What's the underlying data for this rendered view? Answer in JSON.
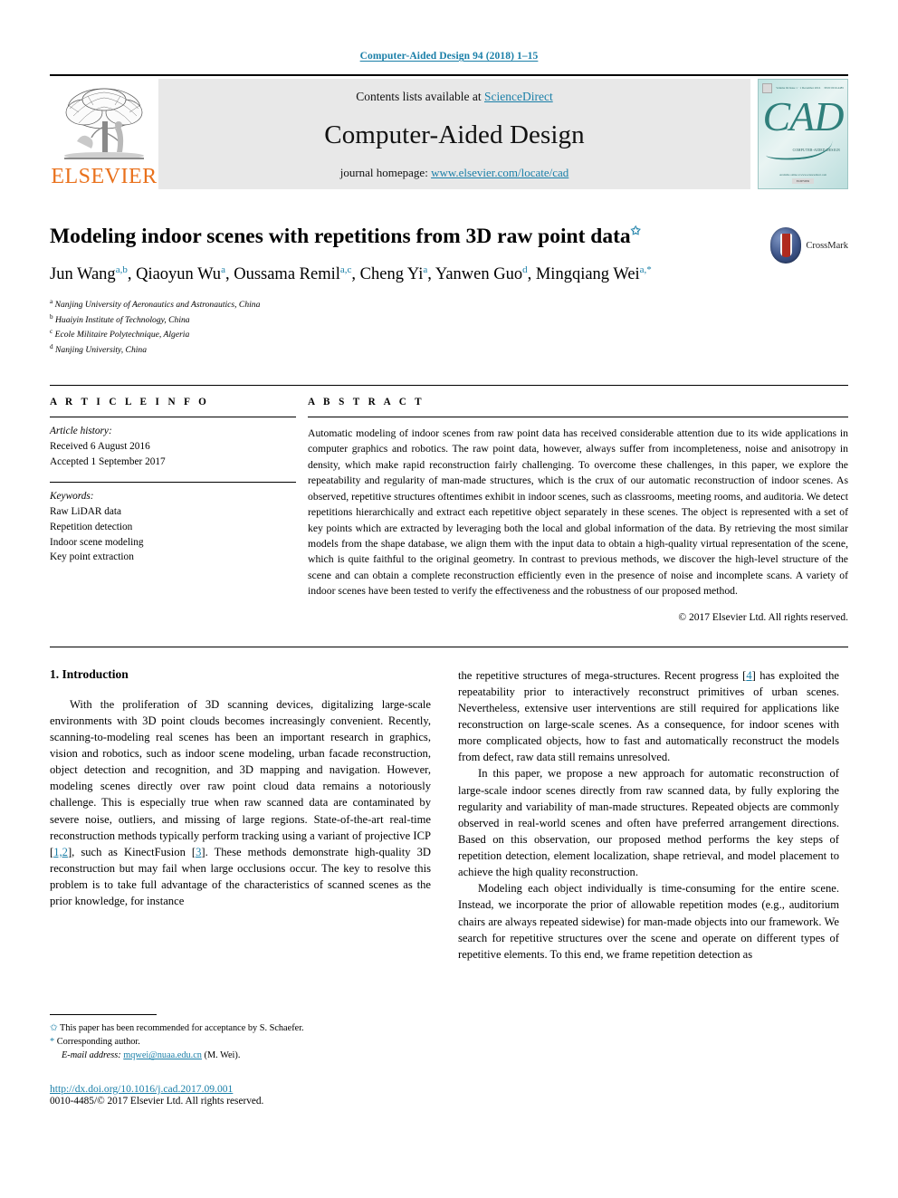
{
  "running_head": "Computer-Aided Design 94 (2018) 1–15",
  "banner": {
    "publisher": "ELSEVIER",
    "contents_prefix": "Contents lists available at ",
    "contents_link": "ScienceDirect",
    "journal_name": "Computer-Aided Design",
    "homepage_prefix": "journal homepage: ",
    "homepage_link": "www.elsevier.com/locate/cad",
    "cover": {
      "letters": "CAD",
      "subtitle": "COMPUTER-AIDED DESIGN",
      "top_left": "Volume 94 Issue 1 · 1 December 2016",
      "top_right": "ISSN 0010-4485",
      "bottom": "Available online at www.sciencedirect.com",
      "bottom_box": "ELSEVIER"
    }
  },
  "article": {
    "title": "Modeling indoor scenes with repetitions from 3D raw point data",
    "title_star": "✩",
    "authors": [
      {
        "name": "Jun Wang",
        "sup": "a,b",
        "sep": ", "
      },
      {
        "name": "Qiaoyun Wu",
        "sup": "a",
        "sep": ", "
      },
      {
        "name": "Oussama Remil",
        "sup": "a,c",
        "sep": ", "
      },
      {
        "name": "Cheng Yi",
        "sup": "a",
        "sep": ", "
      },
      {
        "name": "Yanwen Guo",
        "sup": "d",
        "sep": ", "
      },
      {
        "name": "Mingqiang Wei",
        "sup": "a,*",
        "sep": ""
      }
    ],
    "affiliations": [
      {
        "mark": "a",
        "text": "Nanjing University of Aeronautics and Astronautics, China"
      },
      {
        "mark": "b",
        "text": "Huaiyin Institute of Technology, China"
      },
      {
        "mark": "c",
        "text": "Ecole Militaire Polytechnique, Algeria"
      },
      {
        "mark": "d",
        "text": "Nanjing University, China"
      }
    ],
    "crossmark_label": "CrossMark"
  },
  "article_info": {
    "heading": "A R T I C L E   I N F O",
    "history_label": "Article history:",
    "history": [
      "Received 6 August 2016",
      "Accepted 1 September 2017"
    ],
    "keywords_label": "Keywords:",
    "keywords": [
      "Raw LiDAR data",
      "Repetition detection",
      "Indoor scene modeling",
      "Key point extraction"
    ]
  },
  "abstract": {
    "heading": "A B S T R A C T",
    "text": "Automatic modeling of indoor scenes from raw point data has received considerable attention due to its wide applications in computer graphics and robotics. The raw point data, however, always suffer from incompleteness, noise and anisotropy in density, which make rapid reconstruction fairly challenging. To overcome these challenges, in this paper, we explore the repeatability and regularity of man-made structures, which is the crux of our automatic reconstruction of indoor scenes. As observed, repetitive structures oftentimes exhibit in indoor scenes, such as classrooms, meeting rooms, and auditoria. We detect repetitions hierarchically and extract each repetitive object separately in these scenes. The object is represented with a set of key points which are extracted by leveraging both the local and global information of the data. By retrieving the most similar models from the shape database, we align them with the input data to obtain a high-quality virtual representation of the scene, which is quite faithful to the original geometry. In contrast to previous methods, we discover the high-level structure of the scene and can obtain a complete reconstruction efficiently even in the presence of noise and incomplete scans. A variety of indoor scenes have been tested to verify the effectiveness and the robustness of our proposed method.",
    "rights": "© 2017 Elsevier Ltd. All rights reserved."
  },
  "body": {
    "section_title": "1. Introduction",
    "left_paragraphs": [
      "With the proliferation of 3D scanning devices, digitalizing large-scale environments   with 3D point clouds becomes increasingly convenient. Recently, scanning-to-modeling real scenes has been an important research in graphics, vision and robotics, such as indoor scene modeling, urban facade reconstruction, object detection and recognition, and 3D mapping and navigation. However, modeling scenes directly over raw point cloud data remains a notoriously challenge. This is especially true when raw scanned data are contaminated by severe noise, outliers, and missing of large regions. State-of-the-art real-time reconstruction methods typically perform tracking using a variant of projective ICP [1,2], such as KinectFusion [3]. These methods demonstrate high-quality 3D reconstruction but may fail when large occlusions occur. The key to resolve this problem is to take full advantage of the characteristics of scanned scenes as the prior knowledge, for instance"
    ],
    "right_paragraphs": [
      "the repetitive structures of mega-structures. Recent progress [4] has exploited the repeatability prior to interactively reconstruct primitives of urban scenes. Nevertheless, extensive user interventions are still required for applications like reconstruction on large-scale scenes. As a consequence, for indoor scenes with more complicated objects, how to fast and automatically reconstruct the models from defect, raw data still remains unresolved.",
      "In this paper, we propose a new approach for automatic reconstruction of large-scale indoor scenes directly from raw scanned data, by fully exploring the regularity and variability of man-made structures. Repeated objects are commonly observed in real-world scenes and often have preferred arrangement directions. Based on this observation, our proposed method performs the key steps of repetition detection, element localization, shape retrieval, and model placement to achieve the high quality reconstruction.",
      "Modeling each object individually is time-consuming for the entire scene. Instead, we incorporate the prior of allowable repetition modes (e.g., auditorium chairs are always repeated sidewise) for man-made objects into our framework. We search for repetitive structures over the scene and operate on different types of repetitive elements. To this end, we frame repetition detection as"
    ],
    "citations": [
      "1,2",
      "3",
      "4"
    ]
  },
  "footnotes": {
    "items": [
      {
        "sym": "✩",
        "text": "This paper has been recommended for acceptance by S. Schaefer."
      },
      {
        "sym": "*",
        "text": "Corresponding author."
      }
    ],
    "email_label": "E-mail address:",
    "email": "mqwei@nuaa.edu.cn",
    "email_suffix": "(M. Wei)."
  },
  "doi": {
    "url": "http://dx.doi.org/10.1016/j.cad.2017.09.001",
    "issn_line": "0010-4485/© 2017 Elsevier Ltd. All rights reserved."
  },
  "colors": {
    "link": "#1a7fa8",
    "elsevier_orange": "#E9711C",
    "cad_teal": "#2f7f7b"
  }
}
